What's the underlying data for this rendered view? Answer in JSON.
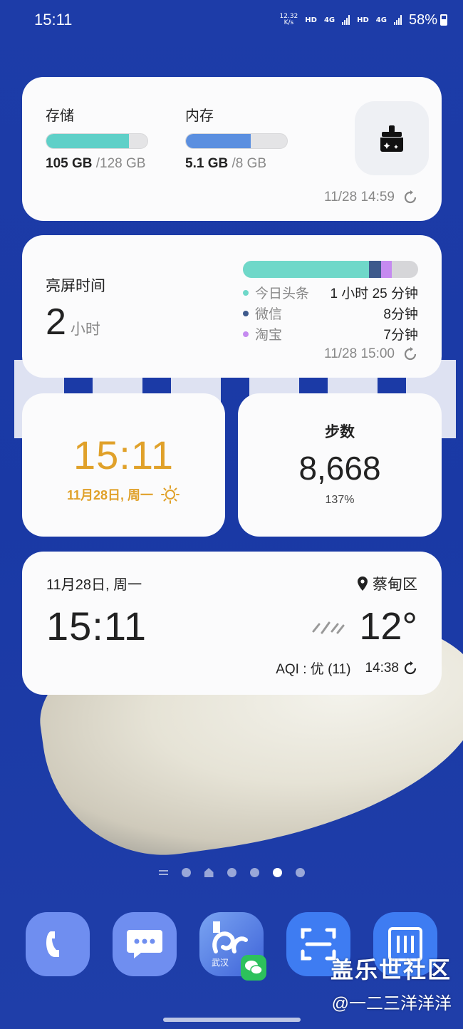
{
  "status_bar": {
    "time": "15:11",
    "net_speed_value": "12.32",
    "net_speed_unit": "K/s",
    "hd1": "HD",
    "net1": "4G",
    "hd2": "HD",
    "net2": "4G",
    "battery": "58%"
  },
  "storage_widget": {
    "storage_label": "存储",
    "storage_used": "105 GB",
    "storage_total": "/128 GB",
    "storage_fraction": 0.82,
    "memory_label": "内存",
    "memory_used": "5.1 GB",
    "memory_total": "/8 GB",
    "memory_fraction": 0.64,
    "updated": "11/28 14:59",
    "colors": {
      "storage_bar": "#5fd0c8",
      "memory_bar": "#5b8fe0"
    }
  },
  "screen_time_widget": {
    "title": "亮屏时间",
    "value": "2",
    "unit": "小时",
    "apps": [
      {
        "name": "今日头条",
        "duration": "1 小时 25 分钟",
        "color": "#6fd8c9",
        "fraction": 0.72
      },
      {
        "name": "微信",
        "duration": "8分钟",
        "color": "#3e5a8c",
        "fraction": 0.07
      },
      {
        "name": "淘宝",
        "duration": "7分钟",
        "color": "#c58af0",
        "fraction": 0.06
      }
    ],
    "updated": "11/28 15:00"
  },
  "clock_widget": {
    "time": "15:11",
    "date": "11月28日, 周一",
    "weather_icon": "sun-icon",
    "accent": "#e0a12a"
  },
  "steps_widget": {
    "title": "步数",
    "value": "8,668",
    "percent": "137%"
  },
  "weather_widget": {
    "date": "11月28日, 周一",
    "time": "15:11",
    "location": "蔡甸区",
    "temperature": "12°",
    "condition_icon": "drizzle-icon",
    "aqi": "AQI : 优 (11)",
    "updated": "14:38"
  },
  "dock": {
    "apps": [
      {
        "name": "phone",
        "icon": "phone-icon",
        "color": "#6f8ef0"
      },
      {
        "name": "messages",
        "icon": "message-icon",
        "color": "#6f8ef0"
      },
      {
        "name": "wuhan-app",
        "icon": "wuhan-app-icon",
        "color": "#4c7be8",
        "label": "武汉"
      },
      {
        "name": "scanner",
        "icon": "scan-icon",
        "color": "#3e7cf2"
      },
      {
        "name": "camera",
        "icon": "barcode-icon",
        "color": "#3e7cf2"
      }
    ]
  },
  "watermark": {
    "line1": "盖乐世社区",
    "line2": "@一二三洋洋洋"
  }
}
